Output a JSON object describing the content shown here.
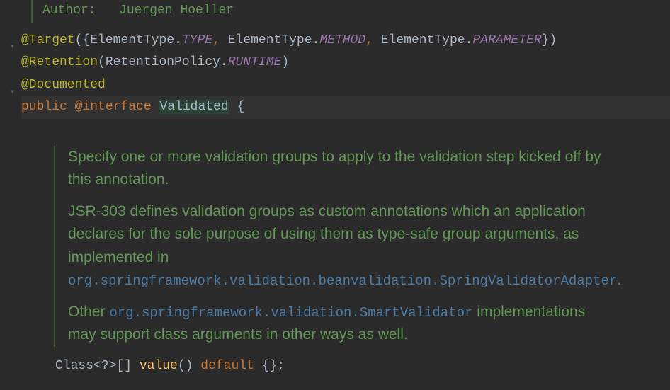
{
  "javadoc": {
    "author_label": "Author:",
    "author_name": "Juergen Hoeller"
  },
  "annotations": {
    "target": "@Target",
    "target_param_open": "({",
    "element_type1": "ElementType",
    "type_const": "TYPE",
    "element_type2": "ElementType",
    "method_const": "METHOD",
    "element_type3": "ElementType",
    "parameter_const": "PARAMETER",
    "target_param_close": "})",
    "retention": "@Retention",
    "retention_param_open": "(",
    "retention_policy": "RetentionPolicy",
    "runtime_const": "RUNTIME",
    "retention_param_close": ")",
    "documented": "@Documented"
  },
  "declaration": {
    "public": "public",
    "at_interface": "@interface",
    "class_name": "Validated",
    "open_brace": " {"
  },
  "method_doc": {
    "para1": "Specify one or more validation groups to apply to the validation step kicked off by this annotation.",
    "para2a": "JSR-303 defines validation groups as custom annotations which an application declares for the sole purpose of using them as type-safe group arguments, as implemented in ",
    "para2_code": "org.springframework.validation.beanvalidation.SpringValidatorAdapter",
    "para2b": ".",
    "para3a": "Other ",
    "para3_code": "org.springframework.validation.SmartValidator",
    "para3b": " implementations may support class arguments in other ways as well."
  },
  "method_line": {
    "class_type": "Class",
    "generic": "<?>[]",
    "method_name": "value",
    "parens": "()",
    "default_kw": "default",
    "default_val": " {};"
  },
  "gutter_icons": {
    "caret_down1": "▾",
    "caret_down2": "▾"
  }
}
